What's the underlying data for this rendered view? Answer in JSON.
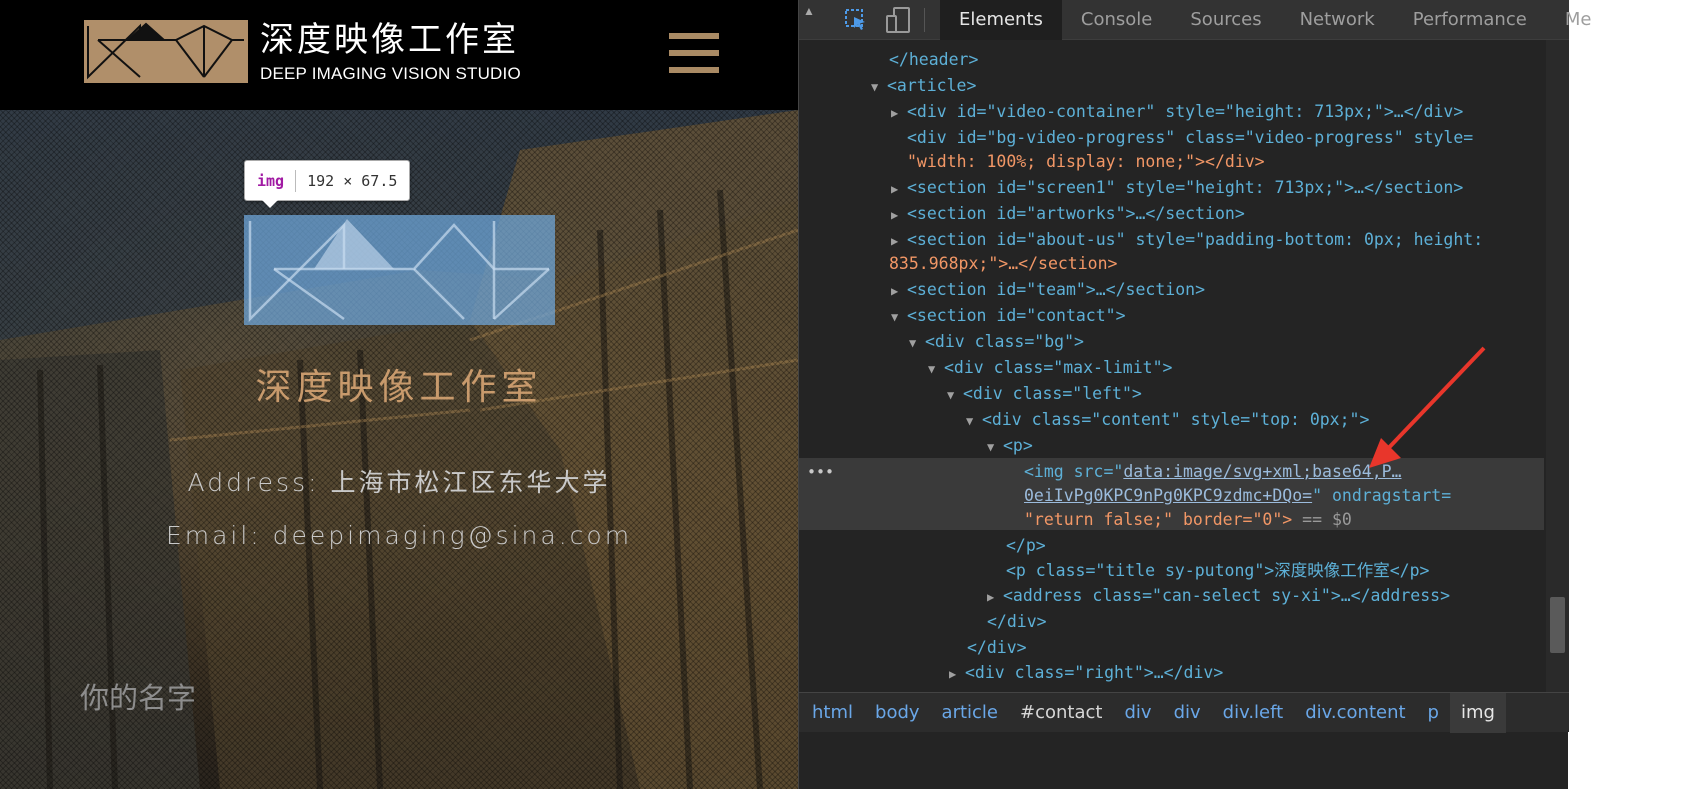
{
  "site": {
    "brand_cn": "深度映像工作室",
    "brand_en": "DEEP IMAGING VISION STUDIO",
    "brand_color": "#b08f6a",
    "menu_icon": "hamburger-icon",
    "tooltip_tag": "img",
    "tooltip_dims": "192 × 67.5",
    "hero_title": "深度映像工作室",
    "address": "Address: 上海市松江区东华大学",
    "email": "Email: deepimaging@sina.com",
    "name_placeholder": "你的名字"
  },
  "devtools": {
    "tabs": [
      "Elements",
      "Console",
      "Sources",
      "Network",
      "Performance",
      "Me"
    ],
    "active_tab": "Elements",
    "code": {
      "l1_close_header": "</header>",
      "l2_article": "<article>",
      "l3_video_container": "<div id=\"video-container\" style=\"height: 713px;\">…</div>",
      "l4a_progress": "<div id=\"bg-video-progress\" class=\"video-progress\" style=",
      "l4b_progress": "\"width: 100%; display: none;\"></div>",
      "l5_screen1": "<section id=\"screen1\" style=\"height: 713px;\">…</section>",
      "l6_artworks": "<section id=\"artworks\">…</section>",
      "l7a_about": "<section id=\"about-us\" style=\"padding-bottom: 0px; height:",
      "l7b_about": "835.968px;\">…</section>",
      "l8_team": "<section id=\"team\">…</section>",
      "l9_contact": "<section id=\"contact\">",
      "l10_bg": "<div class=\"bg\">",
      "l11_maxlimit": "<div class=\"max-limit\">",
      "l12_left": "<div class=\"left\">",
      "l13_content": "<div class=\"content\" style=\"top: 0px;\">",
      "l14_p": "<p>",
      "l15a_img_open": "<img src=\"",
      "l15a_img_src": "data:image/svg+xml;base64,P…",
      "l15b_img_src": "0eiIvPg0KPC9nPg0KPC9zdmc+DQo=",
      "l15b_rest": "\" ondragstart=",
      "l15c_rest": "\"return false;\" border=\"0\">",
      "l15c_sel": " == $0",
      "l16_pclose": "</p>",
      "l17_title": "<p class=\"title sy-putong\">深度映像工作室</p>",
      "l18_address": "<address class=\"can-select sy-xi\">…</address>",
      "l19_divclose": "</div>",
      "l20_divclose": "</div>",
      "l21_right": "<div class=\"right\">…</div>"
    },
    "breadcrumbs": [
      "html",
      "body",
      "article",
      "#contact",
      "div",
      "div",
      "div.left",
      "div.content",
      "p",
      "img"
    ],
    "accent_color": "#5db0d7",
    "arrow_color": "#e8362b"
  }
}
